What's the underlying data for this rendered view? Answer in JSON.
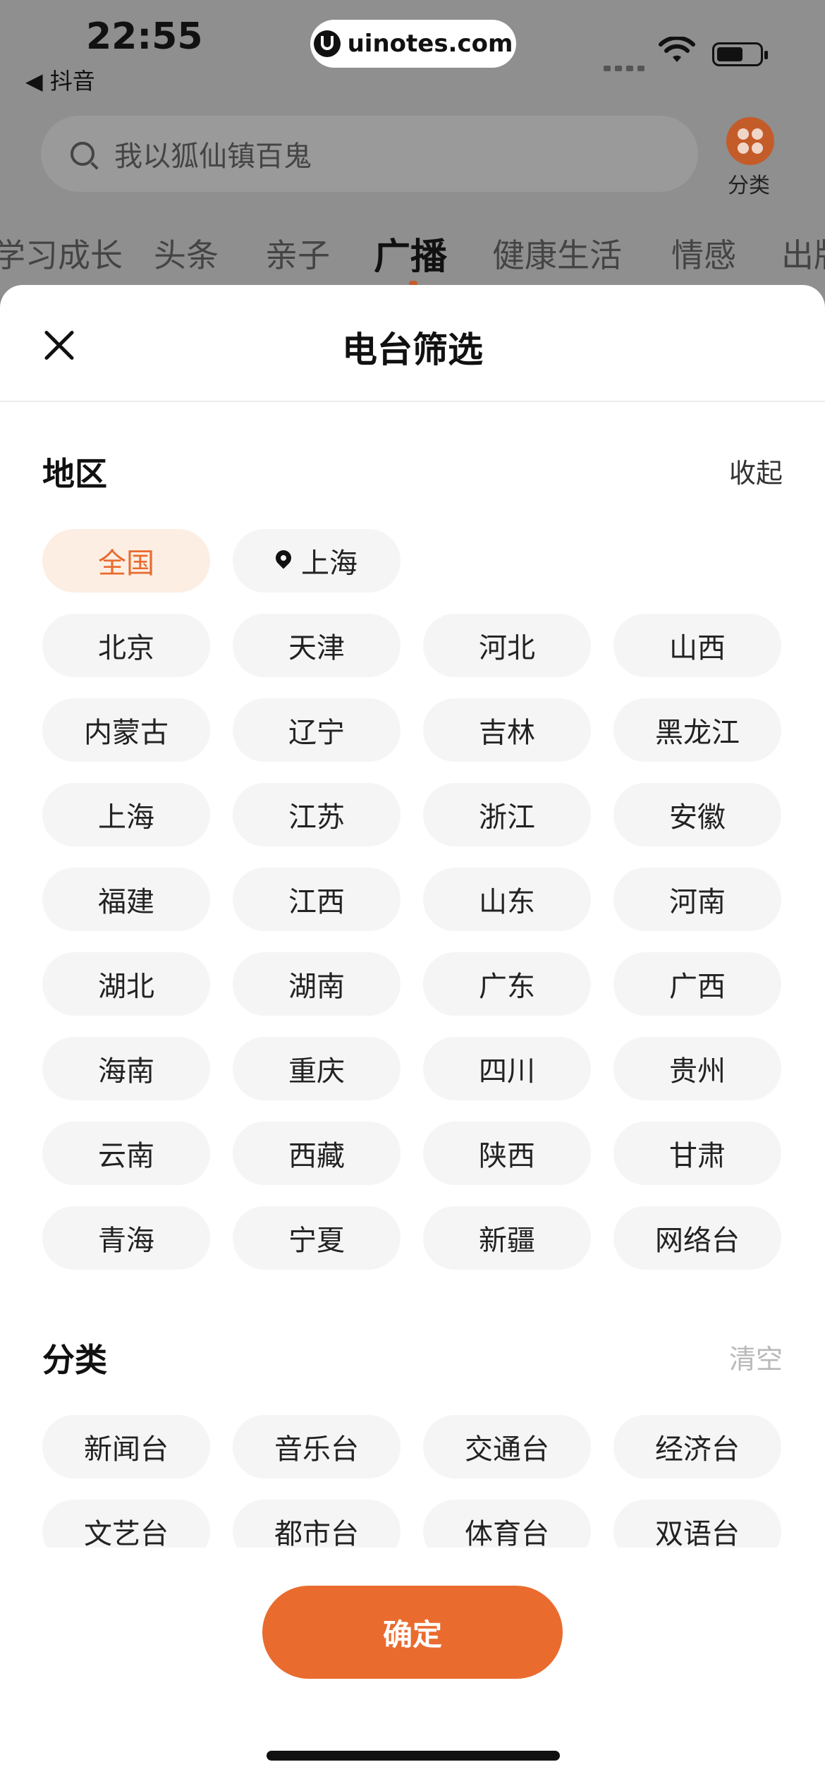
{
  "status": {
    "time": "22:55",
    "back_app": "◀ 抖音"
  },
  "watermark": "uinotes.com",
  "search": {
    "placeholder": "我以狐仙镇百鬼"
  },
  "category_button": {
    "label": "分类"
  },
  "tabs": [
    "学习成长",
    "头条",
    "亲子",
    "广播",
    "健康生活",
    "情感",
    "出版"
  ],
  "active_tab": "广播",
  "sheet": {
    "title": "电台筛选",
    "region": {
      "title": "地区",
      "action": "收起",
      "top_row": [
        "全国",
        "上海"
      ],
      "selected": "全国",
      "provinces": [
        "北京",
        "天津",
        "河北",
        "山西",
        "内蒙古",
        "辽宁",
        "吉林",
        "黑龙江",
        "上海",
        "江苏",
        "浙江",
        "安徽",
        "福建",
        "江西",
        "山东",
        "河南",
        "湖北",
        "湖南",
        "广东",
        "广西",
        "海南",
        "重庆",
        "四川",
        "贵州",
        "云南",
        "西藏",
        "陕西",
        "甘肃",
        "青海",
        "宁夏",
        "新疆",
        "网络台"
      ]
    },
    "category": {
      "title": "分类",
      "action": "清空",
      "items": [
        "新闻台",
        "音乐台",
        "交通台",
        "经济台",
        "文艺台",
        "都市台",
        "体育台",
        "双语台"
      ]
    },
    "confirm_label": "确定"
  },
  "colors": {
    "accent": "#ea6b2e",
    "selected_bg": "#fdeee4",
    "chip_bg": "#f5f5f5"
  }
}
